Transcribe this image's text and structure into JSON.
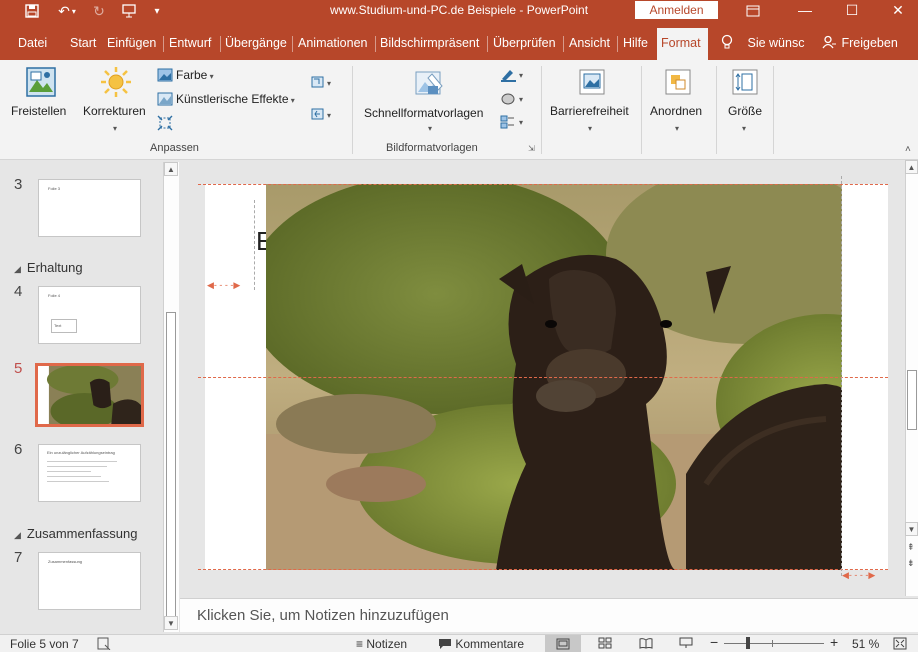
{
  "titlebar": {
    "title": "www.Studium-und-PC.de  Beispiele  -  PowerPoint",
    "signin": "Anmelden",
    "save_icon": "save-icon",
    "undo_icon": "undo-icon",
    "redo_icon": "redo-icon",
    "present_icon": "present-from-start-icon",
    "customize_icon": "customize-toolbar-icon",
    "ribbon_options_icon": "ribbon-display-options-icon",
    "minimize": "—",
    "maximize": "☐",
    "close": "✕"
  },
  "tabs": [
    "Datei",
    "Start",
    "Einfügen",
    "Entwurf",
    "Übergänge",
    "Animationen",
    "Bildschirmpräsent",
    "Überprüfen",
    "Ansicht",
    "Hilfe",
    "Format"
  ],
  "active_tab": "Format",
  "tell_me": "Sie wünsc",
  "share": "Freigeben",
  "ribbon": {
    "freistellen": "Freistellen",
    "korrekturen": "Korrekturen",
    "farbe": "Farbe",
    "kuenstlerische": "Künstlerische Effekte",
    "group_anpassen": "Anpassen",
    "schnellformat": "Schnellformatvorlagen",
    "group_bildformat": "Bildformatvorlagen",
    "barrierefreiheit": "Barrierefreiheit",
    "anordnen": "Anordnen",
    "groesse": "Größe"
  },
  "slides": {
    "items": [
      {
        "num": "3",
        "mini": "Folie 3"
      },
      {
        "num": "4",
        "mini": "Folie 4",
        "mini2": "Text"
      },
      {
        "num": "5"
      },
      {
        "num": "6",
        "mini": "Ein unzulänglicher Aufzählungseintrag"
      },
      {
        "num": "7",
        "mini": "Zusammenfassung"
      }
    ],
    "sections": [
      "Erhaltung",
      "Zusammenfassung"
    ]
  },
  "slide": {
    "title_fragment": "E"
  },
  "notes": {
    "placeholder": "Klicken Sie, um Notizen hinzuzufügen"
  },
  "status": {
    "slide_info": "Folie 5 von 7",
    "notizen": "Notizen",
    "kommentare": "Kommentare",
    "zoom": "51 %",
    "zoom_minus": "−",
    "zoom_plus": "+"
  },
  "colors": {
    "accent": "#b7472a",
    "selection": "#e0694a"
  }
}
